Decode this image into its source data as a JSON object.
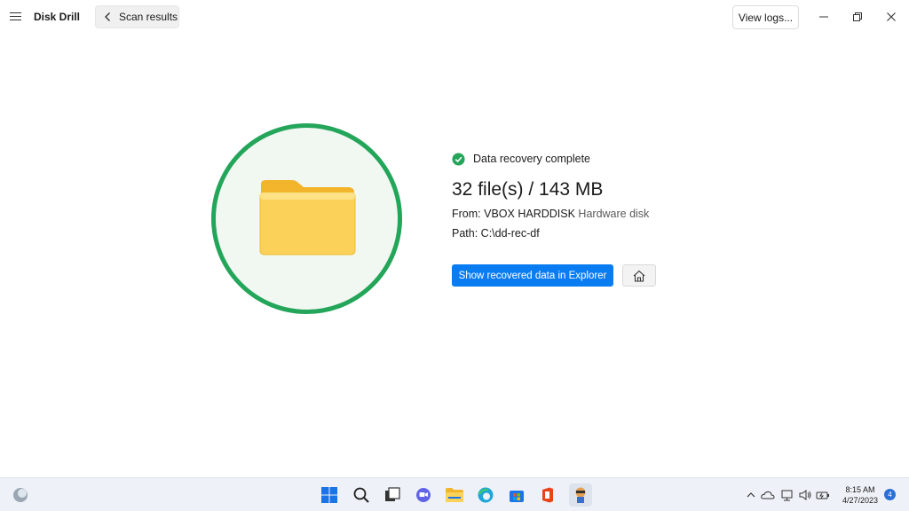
{
  "app": {
    "title": "Disk Drill"
  },
  "toolbar": {
    "back_label": "Scan results",
    "view_logs_label": "View logs..."
  },
  "result": {
    "status_text": "Data recovery complete",
    "summary": "32 file(s) / 143 MB",
    "from_label": "From:",
    "from_device": "VBOX HARDDISK",
    "from_type": "Hardware disk",
    "path_label": "Path:",
    "path_value": "C:\\dd-rec-df"
  },
  "actions": {
    "explorer_label": "Show recovered data in Explorer",
    "home_icon": "home-icon"
  },
  "taskbar": {
    "time": "8:15 AM",
    "date": "4/27/2023",
    "notification_count": "4",
    "apps": [
      "start",
      "search",
      "task-view",
      "chat",
      "file-explorer",
      "edge",
      "store",
      "office",
      "disk-drill"
    ]
  },
  "colors": {
    "accent": "#0a7cf2",
    "success": "#23a55a",
    "folder": "#f6c342"
  }
}
